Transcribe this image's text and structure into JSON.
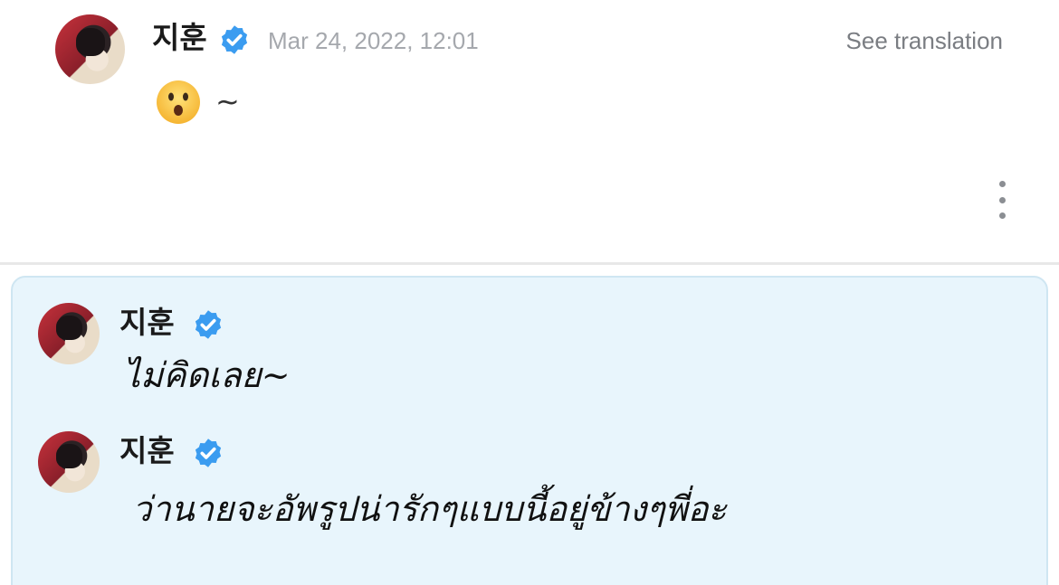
{
  "post": {
    "author_name": "지훈",
    "verified_icon": "verified-badge-icon",
    "timestamp": "Mar 24, 2022, 12:01",
    "translate_label": "See translation",
    "emoji": "hushed-face-emoji",
    "text": "~",
    "more_icon": "more-vertical-icon"
  },
  "replies": [
    {
      "author_name": "지훈",
      "text": "ไม่คิดเลย~"
    },
    {
      "author_name": "지훈",
      "text": "ว่านายจะอัพรูปน่ารักๆแบบนี้อยู่ข้างๆพี่อะ"
    }
  ],
  "colors": {
    "verified_blue": "#3b9cf0",
    "reply_background": "#e8f5fc",
    "timestamp_gray": "#a5a8ad"
  }
}
